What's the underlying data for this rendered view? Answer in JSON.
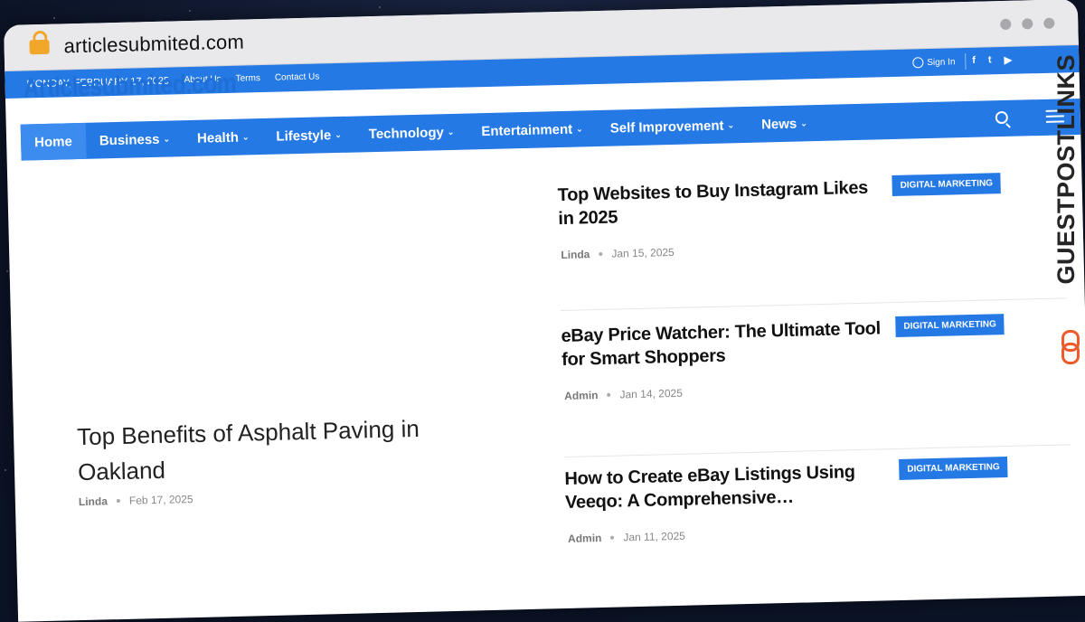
{
  "browser": {
    "url": "articlesubmited.com"
  },
  "topbar": {
    "date": "MONDAY, FEBRUARY 17, 2025",
    "links": [
      "About Us",
      "Terms",
      "Contact Us"
    ],
    "sign_in": "Sign In",
    "socials": [
      "f",
      "t",
      "▶"
    ]
  },
  "site": {
    "logo": "Articlesubmited.com"
  },
  "nav": {
    "items": [
      {
        "label": "Home",
        "active": true,
        "dropdown": false
      },
      {
        "label": "Business",
        "dropdown": true
      },
      {
        "label": "Health",
        "dropdown": true
      },
      {
        "label": "Lifestyle",
        "dropdown": true
      },
      {
        "label": "Technology",
        "dropdown": true
      },
      {
        "label": "Entertainment",
        "dropdown": true
      },
      {
        "label": "Self Improvement",
        "dropdown": true
      },
      {
        "label": "News",
        "dropdown": true
      }
    ],
    "chevron": "⌄"
  },
  "featured": {
    "title": "Top Benefits of Asphalt Paving in Oakland",
    "author": "Linda",
    "date": "Feb 17, 2025"
  },
  "posts": [
    {
      "title": "Top Websites to Buy Instagram Likes in 2025",
      "category": "DIGITAL MARKETING",
      "author": "Linda",
      "date": "Jan 15, 2025"
    },
    {
      "title": "eBay Price Watcher: The Ultimate Tool for Smart Shoppers",
      "category": "DIGITAL MARKETING",
      "author": "Admin",
      "date": "Jan 14, 2025"
    },
    {
      "title": "How to Create eBay Listings Using Veeqo: A Comprehensive…",
      "category": "DIGITAL MARKETING",
      "author": "Admin",
      "date": "Jan 11, 2025"
    }
  ],
  "watermark": {
    "text": "GUESTPOSTLINKS"
  },
  "colors": {
    "accent": "#2479e4",
    "watermark_icon": "#ef5a2a"
  }
}
